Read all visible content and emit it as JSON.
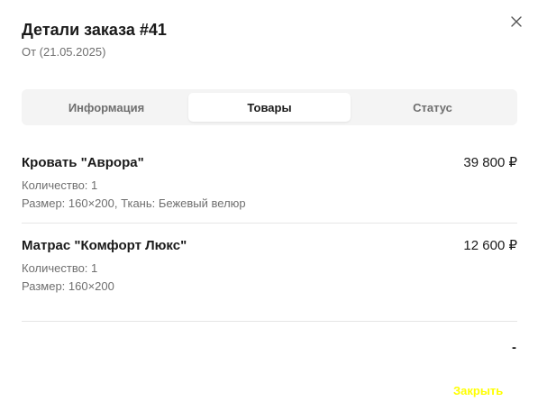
{
  "dialog": {
    "title": "Детали заказа #41",
    "subtitle": "От (21.05.2025)",
    "close_icon": "close-icon",
    "footer_close_label": "Закрыть",
    "footer_close_color": "#ffff00"
  },
  "tabs": [
    {
      "label": "Информация",
      "active": false
    },
    {
      "label": "Товары",
      "active": true
    },
    {
      "label": "Статус",
      "active": false
    }
  ],
  "items": [
    {
      "name": "Кровать \"Аврора\"",
      "price": "39 800 ₽",
      "quantity": "Количество: 1",
      "attributes": "Размер: 160×200, Ткань: Бежевый велюр"
    },
    {
      "name": "Матрас \"Комфорт Люкс\"",
      "price": "12 600 ₽",
      "quantity": "Количество: 1",
      "attributes": "Размер: 160×200"
    }
  ],
  "total": {
    "value": "-"
  }
}
